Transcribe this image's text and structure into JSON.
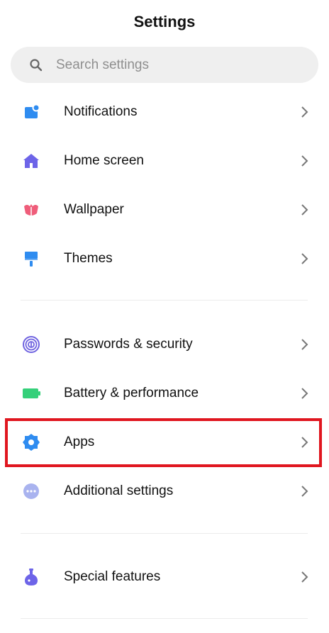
{
  "header": {
    "title": "Settings"
  },
  "search": {
    "placeholder": "Search settings"
  },
  "items": [
    {
      "label": "Notifications",
      "icon": "notifications-icon"
    },
    {
      "label": "Home screen",
      "icon": "home-icon"
    },
    {
      "label": "Wallpaper",
      "icon": "wallpaper-icon"
    },
    {
      "label": "Themes",
      "icon": "themes-icon"
    },
    {
      "label": "Passwords & security",
      "icon": "fingerprint-icon"
    },
    {
      "label": "Battery & performance",
      "icon": "battery-icon"
    },
    {
      "label": "Apps",
      "icon": "apps-gear-icon"
    },
    {
      "label": "Additional settings",
      "icon": "more-icon"
    },
    {
      "label": "Special features",
      "icon": "flask-icon"
    }
  ],
  "colors": {
    "notifications": "#2f8cf0",
    "home": "#6d64e8",
    "wallpaper": "#ef5d7a",
    "themes": "#2f8cf0",
    "passwords": "#6f63e0",
    "battery": "#35d07a",
    "apps": "#2f8cf0",
    "additional": "#a9b3ef",
    "special": "#6d64e8",
    "highlight": "#e0161f"
  }
}
